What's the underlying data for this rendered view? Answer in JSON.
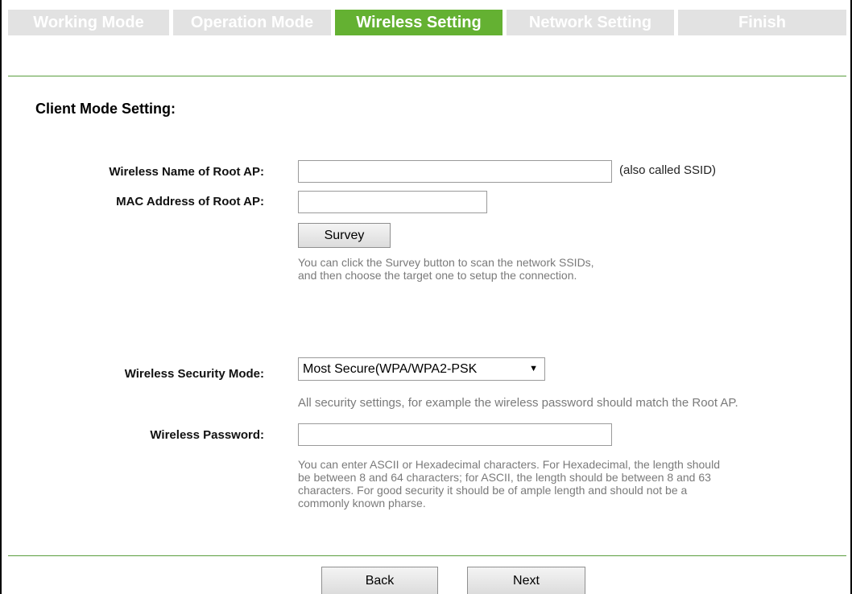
{
  "tabs": [
    {
      "label": "Working Mode",
      "active": false
    },
    {
      "label": "Operation Mode",
      "active": false
    },
    {
      "label": "Wireless Setting",
      "active": true
    },
    {
      "label": "Network Setting",
      "active": false
    },
    {
      "label": "Finish",
      "active": false
    }
  ],
  "section": {
    "title": "Client Mode Setting:"
  },
  "root_ap": {
    "ssid_label": "Wireless Name of Root AP:",
    "ssid_value": "",
    "ssid_note": "(also called SSID)",
    "mac_label": "MAC Address of Root AP:",
    "mac_value": "",
    "survey_label": "Survey",
    "survey_hint_1": "You can click the Survey button to scan the network SSIDs,",
    "survey_hint_2": "and then choose the target one to setup the connection."
  },
  "security": {
    "mode_label": "Wireless Security Mode:",
    "mode_selected": "Most Secure(WPA/WPA2-PSK",
    "mode_hint": "All security settings, for example the wireless password should match the Root AP.",
    "password_label": "Wireless Password:",
    "password_value": "",
    "password_hint_1": "You can enter ASCII or Hexadecimal characters. For Hexadecimal, the length should",
    "password_hint_2": "be between 8 and 64 characters; for ASCII, the length should be between 8 and 63",
    "password_hint_3": "characters. For good security it should be of ample length and should not be a",
    "password_hint_4": "commonly known pharse."
  },
  "footer": {
    "back_label": "Back",
    "next_label": "Next"
  },
  "colors": {
    "active_tab": "#64b132",
    "inactive_tab": "#e2e2e2",
    "rule": "#5a9e3e"
  }
}
